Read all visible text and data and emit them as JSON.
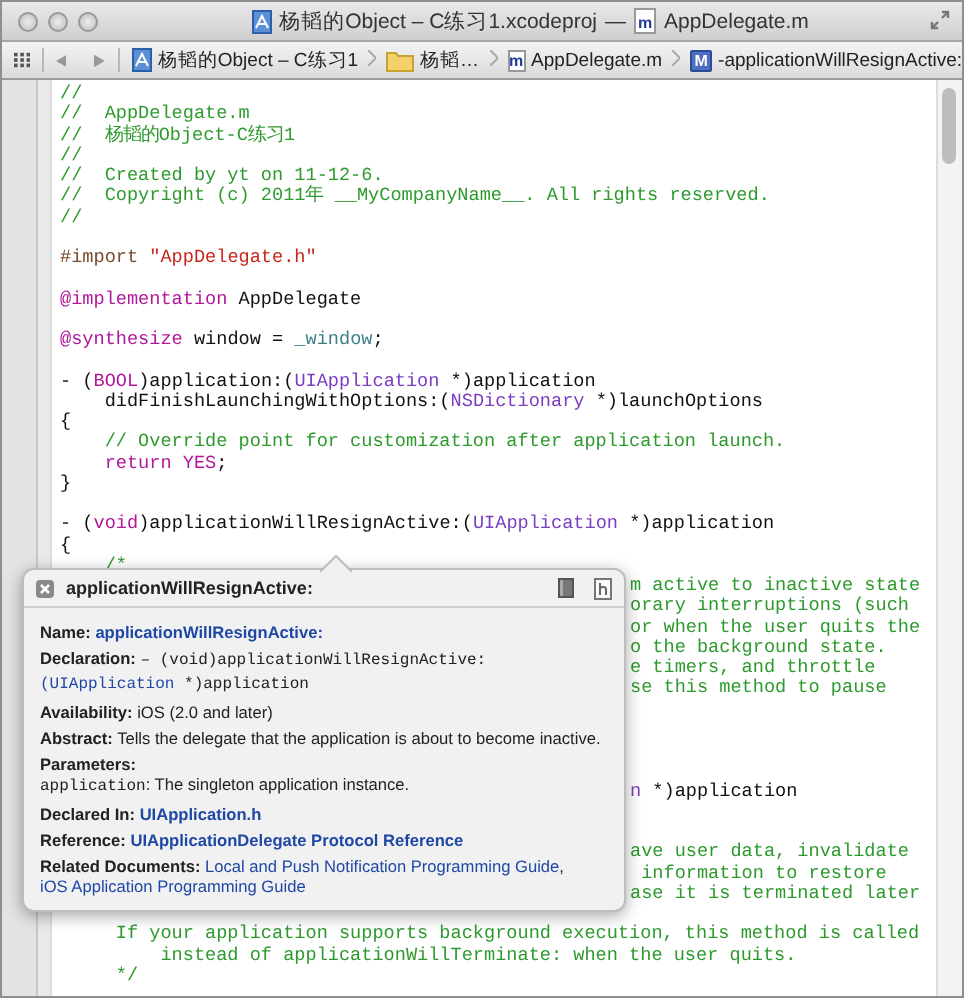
{
  "window": {
    "title_project": "杨韬的Object – C练习1.xcodeproj",
    "title_separator": "—",
    "title_file_badge": "m",
    "title_file": "AppDelegate.m"
  },
  "jump_bar": [
    {
      "kind": "project",
      "label": "杨韬的Object – C练习1"
    },
    {
      "kind": "folder",
      "label": "杨韬…"
    },
    {
      "kind": "file",
      "badge": "m",
      "label": "AppDelegate.m"
    },
    {
      "kind": "method",
      "badge": "M",
      "label": "-applicationWillResignActive:"
    }
  ],
  "code": [
    {
      "kind": "full",
      "tokens": [
        {
          "kind": "comment",
          "text": "//"
        }
      ]
    },
    {
      "kind": "full",
      "tokens": [
        {
          "kind": "comment",
          "text": "//  AppDelegate.m"
        }
      ]
    },
    {
      "kind": "full",
      "tokens": [
        {
          "kind": "comment",
          "text": "//  杨韬的Object-C练习1"
        }
      ]
    },
    {
      "kind": "full",
      "tokens": [
        {
          "kind": "comment",
          "text": "//"
        }
      ]
    },
    {
      "kind": "full",
      "tokens": [
        {
          "kind": "comment",
          "text": "//  Created by yt on 11-12-6."
        }
      ]
    },
    {
      "kind": "full",
      "tokens": [
        {
          "kind": "comment",
          "text": "//  Copyright (c) 2011年 __MyCompanyName__. All rights reserved."
        }
      ]
    },
    {
      "kind": "full",
      "tokens": [
        {
          "kind": "comment",
          "text": "//"
        }
      ]
    },
    {
      "kind": "blank"
    },
    {
      "kind": "full",
      "tokens": [
        {
          "kind": "preproc",
          "text": "#import "
        },
        {
          "kind": "string",
          "text": "\"AppDelegate.h\""
        }
      ]
    },
    {
      "kind": "blank"
    },
    {
      "kind": "full",
      "tokens": [
        {
          "kind": "keyword",
          "text": "@implementation"
        },
        {
          "kind": "plain",
          "text": " AppDelegate"
        }
      ]
    },
    {
      "kind": "blank"
    },
    {
      "kind": "full",
      "tokens": [
        {
          "kind": "keyword",
          "text": "@synthesize"
        },
        {
          "kind": "plain",
          "text": " window = "
        },
        {
          "kind": "ivar",
          "text": "_window"
        },
        {
          "kind": "plain",
          "text": ";"
        }
      ]
    },
    {
      "kind": "blank"
    },
    {
      "kind": "full",
      "tokens": [
        {
          "kind": "plain",
          "text": "- ("
        },
        {
          "kind": "keyword",
          "text": "BOOL"
        },
        {
          "kind": "plain",
          "text": ")application:("
        },
        {
          "kind": "class",
          "text": "UIApplication"
        },
        {
          "kind": "plain",
          "text": " *)application"
        }
      ]
    },
    {
      "kind": "full",
      "tokens": [
        {
          "kind": "plain",
          "text": "    didFinishLaunchingWithOptions:("
        },
        {
          "kind": "class",
          "text": "NSDictionary"
        },
        {
          "kind": "plain",
          "text": " *)launchOptions"
        }
      ]
    },
    {
      "kind": "full",
      "tokens": [
        {
          "kind": "plain",
          "text": "{"
        }
      ]
    },
    {
      "kind": "full",
      "tokens": [
        {
          "kind": "comment",
          "text": "    // Override point for customization after application launch."
        }
      ]
    },
    {
      "kind": "full",
      "tokens": [
        {
          "kind": "keyword",
          "text": "    return YES"
        },
        {
          "kind": "plain",
          "text": ";"
        }
      ]
    },
    {
      "kind": "full",
      "tokens": [
        {
          "kind": "plain",
          "text": "}"
        }
      ]
    },
    {
      "kind": "blank"
    },
    {
      "kind": "full",
      "tokens": [
        {
          "kind": "plain",
          "text": "- ("
        },
        {
          "kind": "keyword",
          "text": "void"
        },
        {
          "kind": "plain",
          "text": ")applicationWillResignActive:("
        },
        {
          "kind": "class",
          "text": "UIApplication"
        },
        {
          "kind": "plain",
          "text": " *)application"
        }
      ]
    },
    {
      "kind": "full",
      "tokens": [
        {
          "kind": "plain",
          "text": "{"
        }
      ]
    },
    {
      "kind": "full",
      "tokens": [
        {
          "kind": "comment",
          "text": "    /*"
        }
      ]
    },
    {
      "kind": "partial",
      "tokens": [
        {
          "kind": "comment",
          "text": "m active to inactive state"
        }
      ]
    },
    {
      "kind": "partial",
      "tokens": [
        {
          "kind": "comment",
          "text": "orary interruptions (such"
        }
      ]
    },
    {
      "kind": "partial",
      "tokens": [
        {
          "kind": "comment",
          "text": "or when the user quits the"
        }
      ]
    },
    {
      "kind": "partial",
      "tokens": [
        {
          "kind": "comment",
          "text": "o the background state."
        }
      ]
    },
    {
      "kind": "partial",
      "tokens": [
        {
          "kind": "comment",
          "text": "e timers, and throttle"
        }
      ]
    },
    {
      "kind": "partial",
      "tokens": [
        {
          "kind": "comment",
          "text": "se this method to pause"
        }
      ]
    },
    {
      "kind": "blank"
    },
    {
      "kind": "blank"
    },
    {
      "kind": "blank"
    },
    {
      "kind": "blank"
    },
    {
      "kind": "partial",
      "tokens": [
        {
          "kind": "class",
          "text": "n"
        },
        {
          "kind": "plain",
          "text": " *)application"
        }
      ]
    },
    {
      "kind": "blank"
    },
    {
      "kind": "blank"
    },
    {
      "kind": "partial",
      "tokens": [
        {
          "kind": "comment",
          "text": "ave user data, invalidate"
        }
      ]
    },
    {
      "kind": "partial",
      "tokens": [
        {
          "kind": "comment",
          "text": " information to restore"
        }
      ]
    },
    {
      "kind": "partial",
      "tokens": [
        {
          "kind": "comment",
          "text": "ase it is terminated later"
        }
      ]
    },
    {
      "kind": "blank"
    },
    {
      "kind": "full",
      "tokens": [
        {
          "kind": "comment",
          "text": "     If your application supports background execution, this method is called"
        }
      ]
    },
    {
      "kind": "full",
      "tokens": [
        {
          "kind": "comment",
          "text": "         instead of applicationWillTerminate: when the user quits."
        }
      ]
    },
    {
      "kind": "full",
      "tokens": [
        {
          "kind": "comment",
          "text": "     */"
        }
      ]
    }
  ],
  "quick_help": {
    "title": "applicationWillResignActive:",
    "rows": [
      {
        "kind": "inline",
        "parts": [
          {
            "kind": "label",
            "text": "Name:"
          },
          {
            "kind": "link",
            "text": "applicationWillResignActive:"
          }
        ]
      },
      {
        "kind": "inline",
        "parts": [
          {
            "kind": "label",
            "text": "Declaration:"
          },
          {
            "kind": "code",
            "text": "– (void)applicationWillResignActive:"
          },
          {
            "kind": "codelink",
            "text": "(UIApplication"
          },
          {
            "kind": "code",
            "text": " *)application"
          }
        ]
      },
      {
        "kind": "inline",
        "parts": [
          {
            "kind": "label",
            "text": "Availability:"
          },
          {
            "kind": "text",
            "text": "iOS (2.0 and later)"
          }
        ]
      },
      {
        "kind": "inline",
        "parts": [
          {
            "kind": "label",
            "text": "Abstract:"
          },
          {
            "kind": "text",
            "text": "Tells the delegate that the application is about to become inactive."
          }
        ]
      },
      {
        "kind": "stacked",
        "parts": [
          {
            "kind": "label",
            "text": "Parameters:"
          },
          {
            "kind": "code",
            "text": "application"
          },
          {
            "kind": "text",
            "text": ": The singleton application instance."
          }
        ]
      },
      {
        "kind": "inline",
        "parts": [
          {
            "kind": "label",
            "text": "Declared In:"
          },
          {
            "kind": "link",
            "text": "UIApplication.h"
          }
        ]
      },
      {
        "kind": "inline",
        "parts": [
          {
            "kind": "label",
            "text": "Reference:"
          },
          {
            "kind": "link",
            "text": "UIApplicationDelegate Protocol Reference"
          }
        ]
      },
      {
        "kind": "inline",
        "parts": [
          {
            "kind": "label",
            "text": "Related Documents:"
          },
          {
            "kind": "link",
            "text": "Local and Push Notification Programming"
          },
          {
            "kind": "link",
            "text": "Guide"
          },
          {
            "kind": "text",
            "text": ", "
          },
          {
            "kind": "link",
            "text": "iOS Application Programming Guide"
          }
        ]
      }
    ]
  }
}
